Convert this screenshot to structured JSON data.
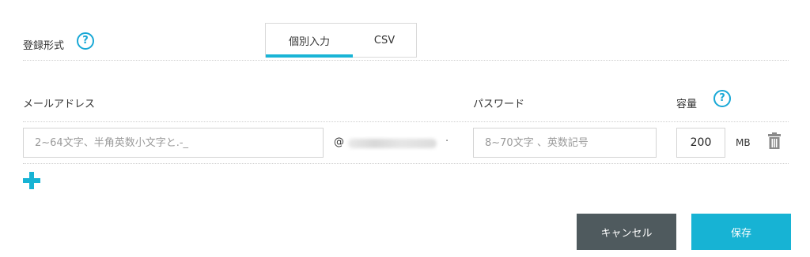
{
  "registration": {
    "label": "登録形式",
    "help_icon": "question-circle-icon",
    "tabs": [
      {
        "label": "個別入力",
        "active": true
      },
      {
        "label": "CSV",
        "active": false
      }
    ]
  },
  "columns": {
    "email": "メールアドレス",
    "password": "パスワード",
    "capacity": "容量",
    "capacity_help_icon": "question-circle-icon"
  },
  "row": {
    "email_placeholder": "2~64文字、半角英数小文字と.-_",
    "at_sign": "@",
    "domain_suffix_dot": "·",
    "password_placeholder": "8~70文字 、英数記号",
    "capacity_value": "200",
    "capacity_unit": "MB",
    "delete_icon": "trash-icon"
  },
  "add_row_icon": "plus-icon",
  "buttons": {
    "cancel": "キャンセル",
    "save": "保存"
  },
  "colors": {
    "accent": "#17b3d4",
    "cancel_bg": "#4f5a5e",
    "help_icon": "#19a8d6"
  }
}
